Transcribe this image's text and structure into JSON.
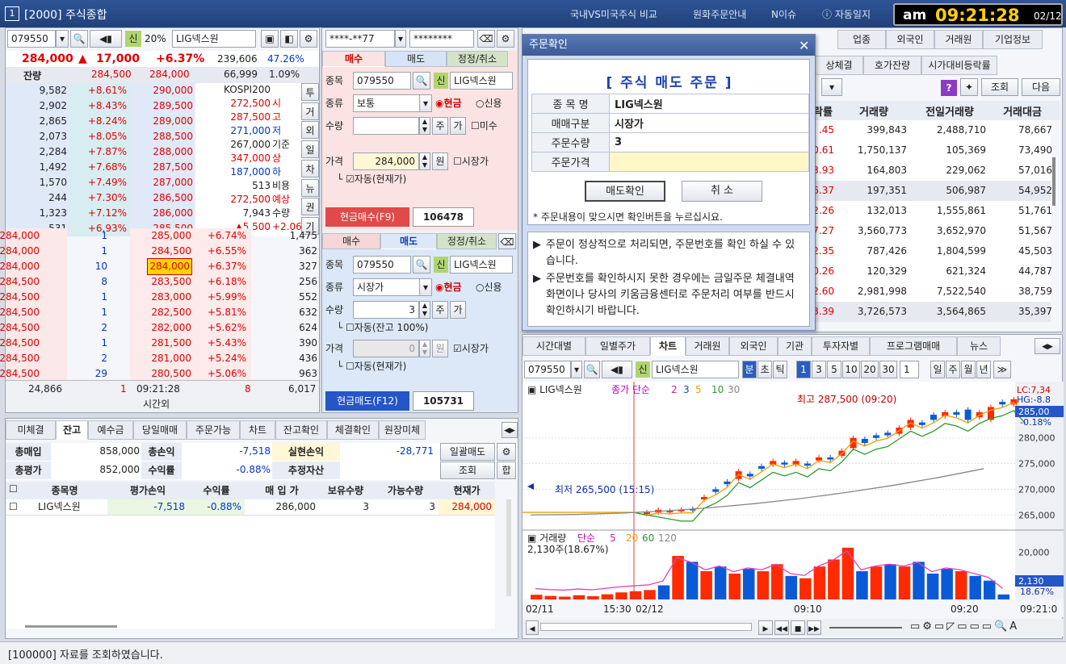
{
  "title": {
    "num": "1",
    "text": "[2000] 주식종합",
    "links": [
      "국내VS미국주식 비교",
      "원화주문안내",
      "N이슈",
      "자동일지"
    ]
  },
  "clock": {
    "ampm": "am",
    "time": "09:21:28",
    "date": "02/12"
  },
  "left": {
    "code": "079550",
    "name": "LIG넥스원",
    "margin": "20%",
    "credit": "신",
    "price": "284,000",
    "arrow": "▲",
    "change": "17,000",
    "pct": "+6.37%",
    "volume": "239,606",
    "vpct": "47.26%",
    "ask_label": "잔량",
    "prev_ask": "284,500",
    "prev_bid": "284,000",
    "prev_vol": "66,999",
    "prev_pct": "1.09%",
    "asks": [
      [
        "9,582",
        "+8.61%",
        "290,000"
      ],
      [
        "2,902",
        "+8.43%",
        "289,500"
      ],
      [
        "2,865",
        "+8.24%",
        "289,000"
      ],
      [
        "2,073",
        "+8.05%",
        "288,500"
      ],
      [
        "2,284",
        "+7.87%",
        "288,000"
      ],
      [
        "1,492",
        "+7.68%",
        "287,500"
      ],
      [
        "1,570",
        "+7.49%",
        "287,000"
      ],
      [
        "244",
        "+7.30%",
        "286,500"
      ],
      [
        "1,323",
        "+7.12%",
        "286,000"
      ],
      [
        "531",
        "+6.93%",
        "285,500"
      ]
    ],
    "info": [
      [
        "KOSPI200",
        ""
      ],
      [
        "272,500",
        "시"
      ],
      [
        "287,500",
        "고"
      ],
      [
        "271,000",
        "저"
      ],
      [
        "267,000",
        "기준"
      ],
      [
        "347,000",
        "상"
      ],
      [
        "187,000",
        "하"
      ],
      [
        "513",
        "비용"
      ],
      [
        "272,500",
        "예상"
      ],
      [
        "7,943",
        "수량"
      ],
      [
        "▲5,500",
        "+2.06%"
      ]
    ],
    "side_tabs": [
      "투",
      "거",
      "외",
      "일",
      "차",
      "뉴",
      "권",
      "기"
    ],
    "trades": [
      [
        "284,000",
        "1"
      ],
      [
        "284,000",
        "1"
      ],
      [
        "284,000",
        "10"
      ],
      [
        "284,500",
        "8"
      ],
      [
        "284,500",
        "1"
      ],
      [
        "284,500",
        "1"
      ],
      [
        "284,500",
        "2"
      ],
      [
        "284,500",
        "1"
      ],
      [
        "284,500",
        "2"
      ],
      [
        "284,500",
        "29"
      ]
    ],
    "bids": [
      [
        "285,000",
        "+6.74%",
        "1,475"
      ],
      [
        "284,500",
        "+6.55%",
        "362"
      ],
      [
        "284,000",
        "+6.37%",
        "327"
      ],
      [
        "283,500",
        "+6.18%",
        "256"
      ],
      [
        "283,000",
        "+5.99%",
        "552"
      ],
      [
        "282,500",
        "+5.81%",
        "632"
      ],
      [
        "282,000",
        "+5.62%",
        "624"
      ],
      [
        "281,500",
        "+5.43%",
        "390"
      ],
      [
        "281,000",
        "+5.24%",
        "436"
      ],
      [
        "280,500",
        "+5.06%",
        "963"
      ]
    ],
    "total_ask": "24,866",
    "mid_n": "1",
    "mid_time": "09:21:28",
    "mid_label": "시간외",
    "mid_b": "8",
    "total_bid": "6,017"
  },
  "order": {
    "account": "****-**77",
    "password": "********",
    "buy_tabs": [
      "매수",
      "매도",
      "정정/취소"
    ],
    "code": "079550",
    "name": "LIG넥스원",
    "credit": "신",
    "type_label": "종목",
    "kind_label": "종류",
    "kind": "보통",
    "cash": "현금",
    "credit_opt": "신용",
    "qty_label": "수량",
    "price_label": "가격",
    "price": "284,000",
    "won": "원",
    "market": "시장가",
    "auto": "자동(현재가)",
    "unsettled": "미수",
    "ju": "주",
    "ga": "가",
    "buy_btn": "현금매수(F9)",
    "buy_amt": "106478",
    "sell_tabs": [
      "매수",
      "매도",
      "정정/취소"
    ],
    "sell_kind": "시장가",
    "sell_qty": "3",
    "sell_price": "0",
    "sell_auto": "자동(잔고 100%)",
    "sell_auto2": "자동(현재가)",
    "sell_btn": "현금매도(F12)",
    "sell_amt": "105731"
  },
  "balance": {
    "tabs": [
      "미체결",
      "잔고",
      "예수금",
      "당일매매",
      "주문가능",
      "차트",
      "잔고확인",
      "체결확인",
      "원장미체"
    ],
    "total_buy_label": "총매입",
    "total_buy": "858,000",
    "total_pl_label": "총손익",
    "total_pl": "-7,518",
    "realized_label": "실현손익",
    "realized": "-28,771",
    "bulk_sell": "일괄매도",
    "total_eval_label": "총평가",
    "total_eval": "852,000",
    "ret_label": "수익률",
    "ret": "-0.88%",
    "est_label": "추정자산",
    "query": "조회",
    "sum": "합",
    "headers": [
      "종목명",
      "평가손익",
      "수익률",
      "매 입 가",
      "보유수량",
      "가능수량",
      "현재가"
    ],
    "rows": [
      [
        "LIG넥스원",
        "-7,518",
        "-0.88%",
        "286,000",
        "3",
        "3",
        "284,000"
      ]
    ]
  },
  "right": {
    "tabs": [
      "업종",
      "외국인",
      "거래원",
      "기업정보"
    ],
    "tabs2": [
      "상체결",
      "호가잔량",
      "시가대비등락률"
    ],
    "query": "조회",
    "next": "다음",
    "headers": [
      "락률",
      "거래량",
      "전일거래량",
      "거래대금"
    ],
    "rows": [
      [
        ".45",
        "399,843",
        "2,488,710",
        "78,667"
      ],
      [
        "0.61",
        "1,750,137",
        "105,369",
        "73,490"
      ],
      [
        "3.93",
        "164,803",
        "229,062",
        "57,016"
      ],
      [
        "6.37",
        "197,351",
        "506,987",
        "54,952"
      ],
      [
        "2.26",
        "132,013",
        "1,555,861",
        "51,761"
      ],
      [
        "7.27",
        "3,560,773",
        "3,652,970",
        "51,567"
      ],
      [
        "2.35",
        "787,426",
        "1,804,599",
        "45,503"
      ],
      [
        "0.26",
        "120,329",
        "621,324",
        "44,787"
      ],
      [
        "2.60",
        "2,981,998",
        "7,522,540",
        "38,759"
      ],
      [
        "3.39",
        "3,726,573",
        "3,564,865",
        "35,397"
      ]
    ]
  },
  "chart": {
    "tabs": [
      "시간대별",
      "일별주가",
      "차트",
      "거래원",
      "외국인",
      "기관",
      "투자자별",
      "프로그램매매",
      "뉴스"
    ],
    "code": "079550",
    "name": "LIG넥스원",
    "units": [
      "분",
      "초",
      "틱"
    ],
    "periods": [
      "1",
      "3",
      "5",
      "10",
      "20",
      "30"
    ],
    "sel": "1",
    "dwmy": [
      "일",
      "주",
      "월",
      "년"
    ],
    "legend_name": "LIG넥스원",
    "legend_ma": "종가 단순",
    "ma": [
      "2",
      "3",
      "5",
      "10",
      "30"
    ],
    "high": "최고 287,500 (09:20)",
    "low": "최저 265,500 (15:15)",
    "lc": "LC:7,34",
    "hg": "HG:-8.8",
    "last": "285,00",
    "last_pct": "-0.18%",
    "yticks": [
      "280,000",
      "275,000",
      "270,000",
      "265,000"
    ],
    "vol_legend": "거래량",
    "vol_ma_label": "단순",
    "vol_ma": [
      "5",
      "20",
      "60",
      "120"
    ],
    "vol_text": "2,130주(18.67%)",
    "vol_ytick": "20,000",
    "vol_last": "2,130",
    "vol_pct": "18.67%",
    "xticks": [
      "02/11",
      "15:30",
      "02/12",
      "09:10",
      "09:20",
      "09:21:0"
    ],
    "colors": {
      "up": "#ff2a00",
      "down": "#0a5ad8",
      "ma5": "#f0a000",
      "ma10": "#2a9a2a",
      "ma30": "#888888"
    }
  },
  "dialog": {
    "title": "주문확인",
    "heading": "[ 주식 매도 주문 ]",
    "rows": [
      [
        "종 목 명",
        "LIG넥스원"
      ],
      [
        "매매구분",
        "시장가"
      ],
      [
        "주문수량",
        "3"
      ],
      [
        "주문가격",
        ""
      ]
    ],
    "confirm": "매도확인",
    "cancel": "취 소",
    "note": "* 주문내용이 맞으시면 확인버튼을 누르십시요.",
    "info1": "주문이 정상적으로 처리되면, 주문번호를 확인 하실 수 있습니다.",
    "info2": "주문번호를 확인하시지 못한 경우에는 금일주문 체결내역 화면이나 당사의 키움금융센터로 주문처리 여부를 반드시 확인하시기 바랍니다."
  },
  "status": "[100000] 자료를 조회하였습니다."
}
